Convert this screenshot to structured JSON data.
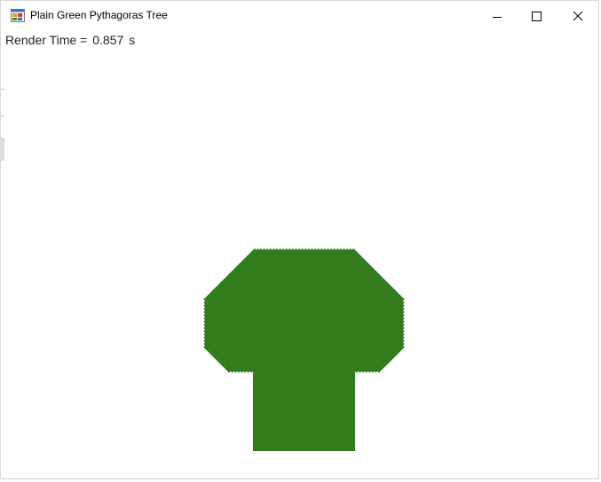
{
  "window": {
    "title": "Plain Green Pythagoras Tree",
    "icon": "windows-forms-app-icon",
    "controls": {
      "minimize_icon": "minimize-icon",
      "maximize_icon": "maximize-icon",
      "close_icon": "close-icon"
    }
  },
  "status": {
    "label": "Render Time =",
    "value": "0.857",
    "unit": "s"
  },
  "tree": {
    "color": "#337c1d",
    "depth": 11,
    "branch_angle_deg": 45
  }
}
